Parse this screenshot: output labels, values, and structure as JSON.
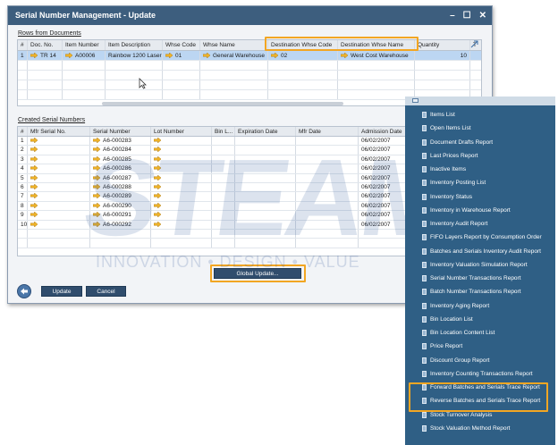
{
  "window": {
    "title": "Serial Number Management - Update",
    "min_icon": "minimize-icon",
    "max_icon": "maximize-icon",
    "close_icon": "close-icon"
  },
  "documents": {
    "label": "Rows from Documents",
    "headers": [
      "#",
      "Doc. No.",
      "Item Number",
      "Item Description",
      "Whse Code",
      "Whse Name",
      "Destination Whse Code",
      "Destination Whse Name",
      "Quantity",
      "T"
    ],
    "rows": [
      [
        "1",
        "TR 14",
        "A00006",
        "Rainbow 1200 Laser",
        "01",
        "General Warehouse",
        "02",
        "West Cost Warehouse",
        "10",
        ""
      ]
    ]
  },
  "serials": {
    "label": "Created Serial Numbers",
    "headers": [
      "#",
      "Mfr Serial No.",
      "Serial Number",
      "Lot Number",
      "Bin L...",
      "Expiration Date",
      "Mfr Date",
      "Admission Date"
    ],
    "rows": [
      [
        "1",
        "",
        "A6-000283",
        "",
        "",
        "",
        "",
        "06/02/2007"
      ],
      [
        "2",
        "",
        "A6-000284",
        "",
        "",
        "",
        "",
        "06/02/2007"
      ],
      [
        "3",
        "",
        "A6-000285",
        "",
        "",
        "",
        "",
        "06/02/2007"
      ],
      [
        "4",
        "",
        "A6-000286",
        "",
        "",
        "",
        "",
        "06/02/2007"
      ],
      [
        "5",
        "",
        "A6-000287",
        "",
        "",
        "",
        "",
        "06/02/2007"
      ],
      [
        "6",
        "",
        "A6-000288",
        "",
        "",
        "",
        "",
        "06/02/2007"
      ],
      [
        "7",
        "",
        "A6-000289",
        "",
        "",
        "",
        "",
        "06/02/2007"
      ],
      [
        "8",
        "",
        "A6-000290",
        "",
        "",
        "",
        "",
        "06/02/2007"
      ],
      [
        "9",
        "",
        "A6-000291",
        "",
        "",
        "",
        "",
        "06/02/2007"
      ],
      [
        "10",
        "",
        "A6-000292",
        "",
        "",
        "",
        "",
        "06/02/2007"
      ]
    ]
  },
  "buttons": {
    "global_update": "Global Update...",
    "update": "Update",
    "cancel": "Cancel"
  },
  "watermark": {
    "big": "STEAM",
    "small": "INNOVATION • DESIGN • VALUE"
  },
  "menu": {
    "items": [
      "Items List",
      "Open Items List",
      "Document Drafts Report",
      "Last Prices Report",
      "Inactive Items",
      "Inventory Posting List",
      "Inventory Status",
      "Inventory in Warehouse Report",
      "Inventory Audit Report",
      "FIFO Layers Report by Consumption Order",
      "Batches and Serials Inventory Audit Report",
      "Inventory Valuation Simulation Report",
      "Serial Number Transactions Report",
      "Batch Number Transactions Report",
      "Inventory Aging Report",
      "Bin Location List",
      "Bin Location Content List",
      "Price Report",
      "Discount Group Report",
      "Inventory Counting Transactions Report",
      "Forward Batches and Serials Trace Report",
      "Reverse Batches and Serials Trace Report",
      "Stock Turnover Analysis",
      "Stock Valuation Method Report"
    ]
  },
  "colors": {
    "titlebar": "#3d5e7e",
    "highlight": "#f2a623",
    "menu_bg": "#2f5f85",
    "arrow": "#f0b429",
    "selected_row": "#bcd6f2"
  }
}
